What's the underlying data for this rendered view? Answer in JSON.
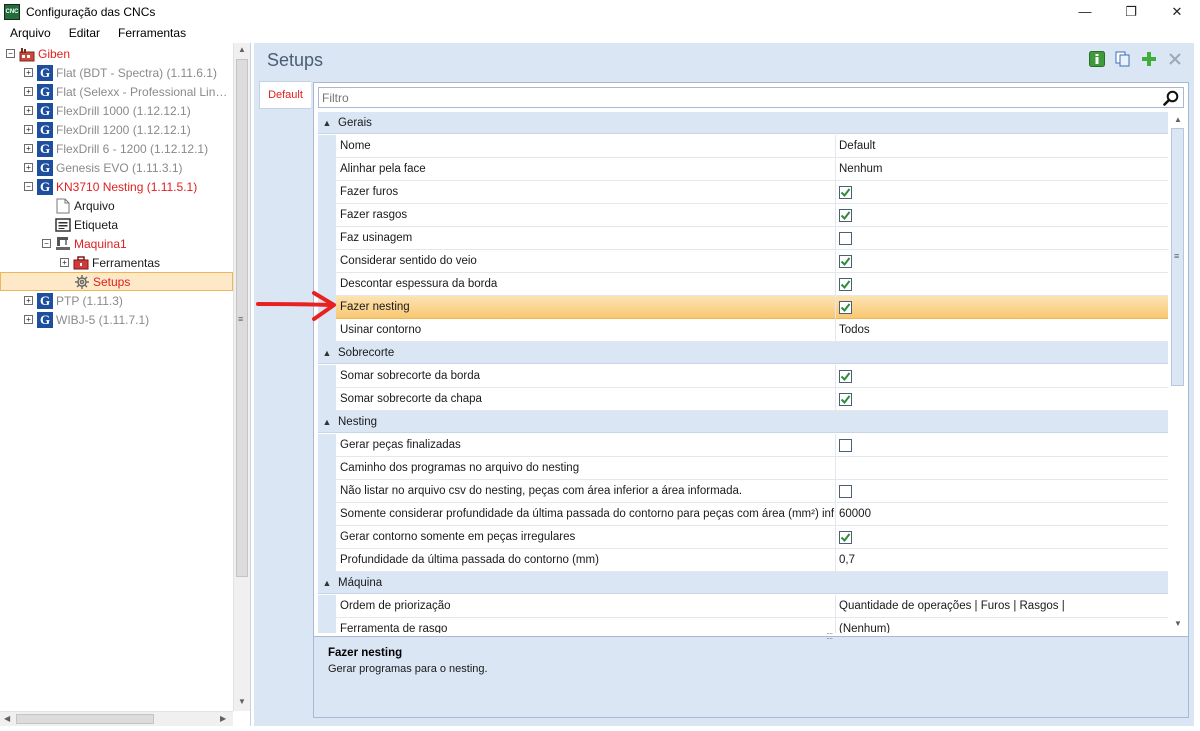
{
  "window": {
    "title": "Configuração das CNCs",
    "app_icon_text": "CNC",
    "minimize": "—",
    "maximize": "❐",
    "close": "✕"
  },
  "menu": [
    "Arquivo",
    "Editar",
    "Ferramentas"
  ],
  "tree": [
    {
      "label": "Giben",
      "depth": 0,
      "expander": "−",
      "icon": "factory-icon",
      "color": "red"
    },
    {
      "label": "Flat (BDT - Spectra) (1.11.6.1)",
      "depth": 1,
      "expander": "+",
      "icon": "machine-g-icon",
      "color": "gray"
    },
    {
      "label": "Flat (Selexx - Professional Lin…",
      "depth": 1,
      "expander": "+",
      "icon": "machine-g-icon",
      "color": "gray"
    },
    {
      "label": "FlexDrill 1000 (1.12.12.1)",
      "depth": 1,
      "expander": "+",
      "icon": "machine-g-icon",
      "color": "gray"
    },
    {
      "label": "FlexDrill 1200 (1.12.12.1)",
      "depth": 1,
      "expander": "+",
      "icon": "machine-g-icon",
      "color": "gray"
    },
    {
      "label": "FlexDrill 6 - 1200 (1.12.12.1)",
      "depth": 1,
      "expander": "+",
      "icon": "machine-g-icon",
      "color": "gray"
    },
    {
      "label": "Genesis EVO (1.11.3.1)",
      "depth": 1,
      "expander": "+",
      "icon": "machine-g-icon",
      "color": "gray"
    },
    {
      "label": "KN3710 Nesting (1.11.5.1)",
      "depth": 1,
      "expander": "−",
      "icon": "machine-g-icon",
      "color": "red"
    },
    {
      "label": "Arquivo",
      "depth": 2,
      "expander": "",
      "icon": "file-icon",
      "color": "dark"
    },
    {
      "label": "Etiqueta",
      "depth": 2,
      "expander": "",
      "icon": "label-icon",
      "color": "dark"
    },
    {
      "label": "Maquina1",
      "depth": 2,
      "expander": "−",
      "icon": "machine-icon",
      "color": "red"
    },
    {
      "label": "Ferramentas",
      "depth": 3,
      "expander": "+",
      "icon": "toolbox-icon",
      "color": "dark"
    },
    {
      "label": "Setups",
      "depth": 3,
      "expander": "",
      "icon": "gear-icon",
      "color": "red",
      "selected": true
    },
    {
      "label": "PTP (1.11.3)",
      "depth": 1,
      "expander": "+",
      "icon": "machine-g-icon",
      "color": "gray"
    },
    {
      "label": "WIBJ-5 (1.11.7.1)",
      "depth": 1,
      "expander": "+",
      "icon": "machine-g-icon",
      "color": "gray"
    }
  ],
  "main": {
    "title": "Setups",
    "tab": "Default",
    "filter_placeholder": "Filtro"
  },
  "grid": [
    {
      "category": "Gerais"
    },
    {
      "name": "Nome",
      "value": "Default"
    },
    {
      "name": "Alinhar pela face",
      "value": "Nenhum"
    },
    {
      "name": "Fazer furos",
      "check": true
    },
    {
      "name": "Fazer rasgos",
      "check": true
    },
    {
      "name": "Faz usinagem",
      "check": false
    },
    {
      "name": "Considerar sentido do veio",
      "check": true
    },
    {
      "name": "Descontar espessura da borda",
      "check": true
    },
    {
      "name": "Fazer nesting",
      "check": true,
      "selected": true
    },
    {
      "name": "Usinar contorno",
      "value": "Todos"
    },
    {
      "category": "Sobrecorte"
    },
    {
      "name": "Somar sobrecorte da borda",
      "check": true
    },
    {
      "name": "Somar sobrecorte da chapa",
      "check": true
    },
    {
      "category": "Nesting"
    },
    {
      "name": "Gerar peças finalizadas",
      "check": false
    },
    {
      "name": "Caminho dos programas no arquivo do nesting",
      "value": ""
    },
    {
      "name": "Não listar no arquivo csv do nesting, peças com área inferior a área informada.",
      "check": false
    },
    {
      "name": "Somente considerar profundidade da última passada do contorno para peças com área (mm²) inf…",
      "value": "60000"
    },
    {
      "name": "Gerar contorno somente em peças irregulares",
      "check": true
    },
    {
      "name": "Profundidade da última passada do contorno (mm)",
      "value": "0,7"
    },
    {
      "category": "Máquina"
    },
    {
      "name": "Ordem de priorização",
      "value": "Quantidade de operações | Furos | Rasgos |"
    },
    {
      "name": "Ferramenta de rasgo",
      "value": "(Nenhum)"
    }
  ],
  "description": {
    "title": "Fazer nesting",
    "text": "Gerar programas para o nesting."
  },
  "colors": {
    "accent_red": "#e02020",
    "selection_orange": "#f8c873",
    "panel_blue": "#dbe6f4",
    "check_green": "#2e8b3a"
  }
}
